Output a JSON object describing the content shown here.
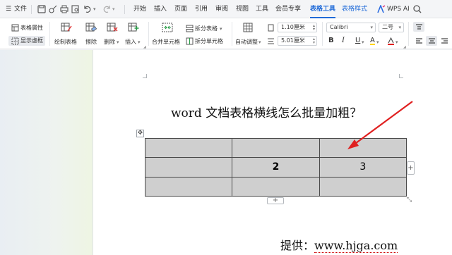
{
  "menu": {
    "file": "文件",
    "tabs": [
      "开始",
      "插入",
      "页面",
      "引用",
      "审阅",
      "视图",
      "工具",
      "会员专享",
      "表格工具",
      "表格样式"
    ],
    "active_tab": "表格工具",
    "wps_ai": "WPS AI"
  },
  "ribbon": {
    "table_props": "表格属性",
    "show_gridlines": "显示虚框",
    "draw_table": "绘制表格",
    "eraser": "擦除",
    "delete": "删除",
    "insert": "插入",
    "merge_cells": "合并单元格",
    "split_table": "拆分表格",
    "split_cells": "拆分单元格",
    "auto_fit": "自动调整",
    "row_height": "1.10厘米",
    "col_width": "5.01厘米",
    "font_name": "Calibri",
    "font_size": "二号",
    "bold": "B",
    "italic": "I",
    "underline": "U",
    "highlight": "A"
  },
  "document": {
    "title": "word 文档表格横线怎么批量加粗？",
    "table": [
      [
        "",
        "",
        ""
      ],
      [
        "",
        "2",
        "3"
      ],
      [
        "",
        "",
        ""
      ]
    ],
    "add_symbol": "+",
    "credit_label": "提供：",
    "credit_url": "www.hjga.com"
  },
  "colors": {
    "accent": "#1f6ad8",
    "arrow": "#e02020",
    "cell_fill": "#cfcfcf"
  }
}
